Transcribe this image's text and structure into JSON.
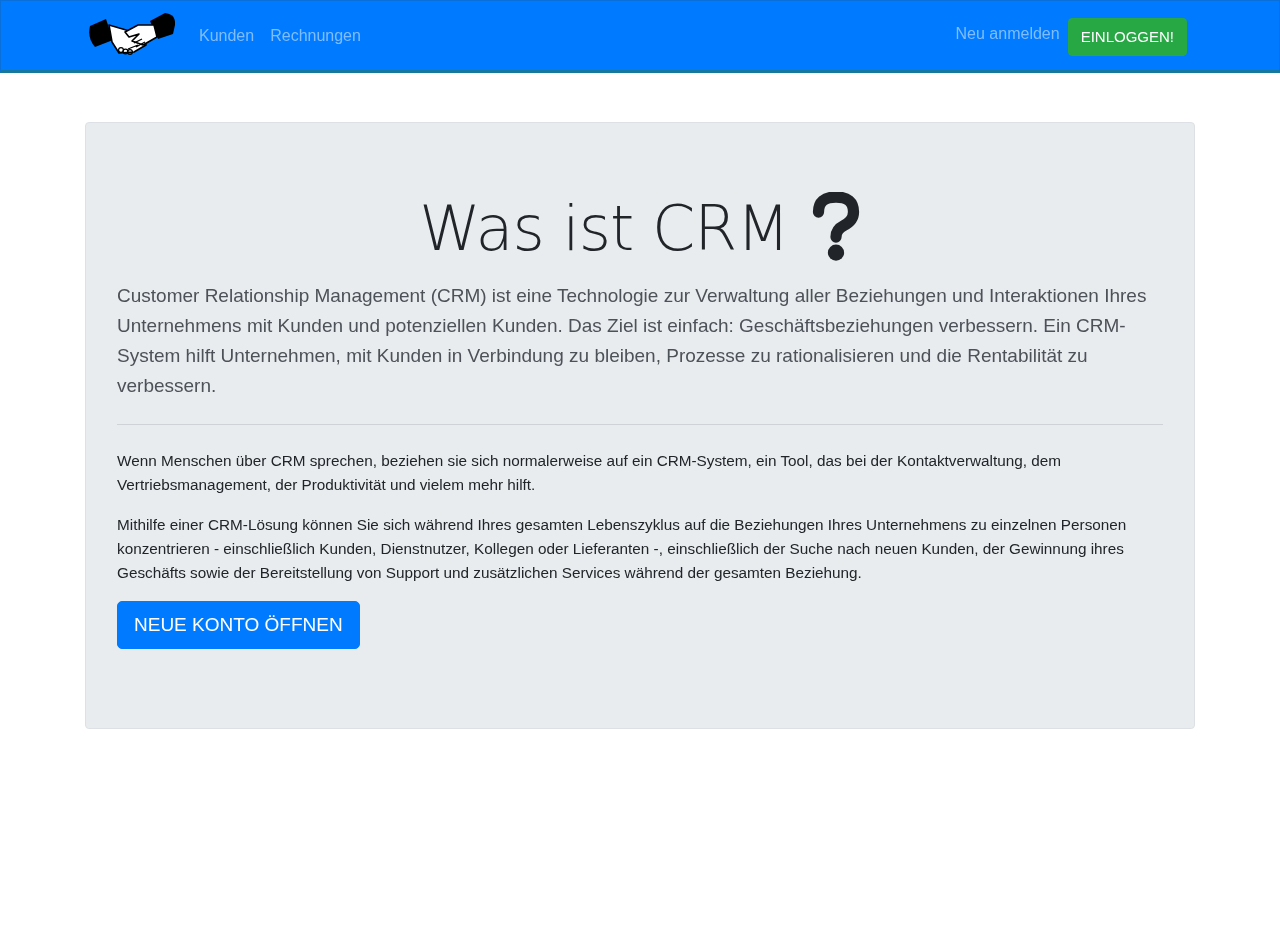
{
  "navbar": {
    "links": [
      {
        "label": "Kunden"
      },
      {
        "label": "Rechnungen"
      }
    ],
    "register_link": "Neu anmelden",
    "login_button": "EINLOGGEN!"
  },
  "hero": {
    "title": "Was ist CRM",
    "lead": "Customer Relationship Management (CRM) ist eine Technologie zur Verwaltung aller Beziehungen und Interaktionen Ihres Unternehmens mit Kunden und potenziellen Kunden. Das Ziel ist einfach: Geschäftsbeziehungen verbessern. Ein CRM-System hilft Unternehmen, mit Kunden in Verbindung zu bleiben, Prozesse zu rationalisieren und die Rentabilität zu verbessern.",
    "paragraphs": [
      "Wenn Menschen über CRM sprechen, beziehen sie sich normalerweise auf ein CRM-System, ein Tool, das bei der Kontaktverwaltung, dem Vertriebsmanagement, der Produktivität und vielem mehr hilft.",
      "Mithilfe einer CRM-Lösung können Sie sich während Ihres gesamten Lebenszyklus auf die Beziehungen Ihres Unternehmens zu einzelnen Personen konzentrieren - einschließlich Kunden, Dienstnutzer, Kollegen oder Lieferanten -, einschließlich der Suche nach neuen Kunden, der Gewinnung ihres Geschäfts sowie der Bereitstellung von Support und zusätzlichen Services während der gesamten Beziehung."
    ],
    "button": "NEUE KONTO ÖFFNEN"
  }
}
